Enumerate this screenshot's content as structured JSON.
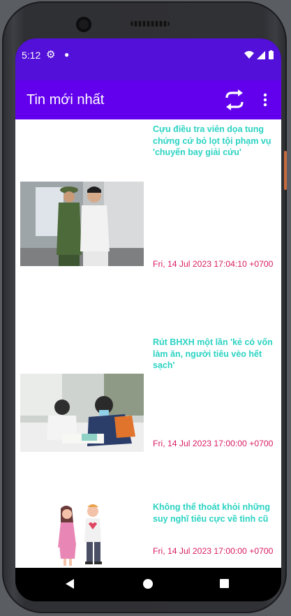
{
  "status_bar": {
    "time": "5:12",
    "icons": [
      "settings-gear-icon",
      "notification-dot-icon",
      "wifi-icon",
      "signal-icon",
      "battery-icon"
    ]
  },
  "app_bar": {
    "title": "Tin mới nhất",
    "actions": [
      "refresh-icon",
      "overflow-menu-icon"
    ]
  },
  "articles": [
    {
      "title": "Cựu điều tra viên dọa tung chứng cứ bỏ lọt tội phạm vụ 'chuyến bay giải cứu'",
      "date": "Fri, 14 Jul 2023 17:04:10 +0700",
      "image": "court-escort-photo"
    },
    {
      "title": "Rút BHXH một lần 'kẻ có vốn làm ăn, người tiêu vèo hết sạch'",
      "date": "Fri, 14 Jul 2023 17:00:00 +0700",
      "image": "workers-filling-forms-photo"
    },
    {
      "title": "Không thể thoát khỏi những suy nghĩ tiêu cực về tình cũ",
      "date": "Fri, 14 Jul 2023 17:00:00 +0700",
      "image": "couple-illustration"
    }
  ],
  "colors": {
    "status_bar": "#5210d8",
    "app_bar": "#6200ee",
    "title_text": "#2bd3c3",
    "date_text": "#d81b60"
  },
  "nav_bar": [
    "back-icon",
    "home-icon",
    "recents-icon"
  ]
}
